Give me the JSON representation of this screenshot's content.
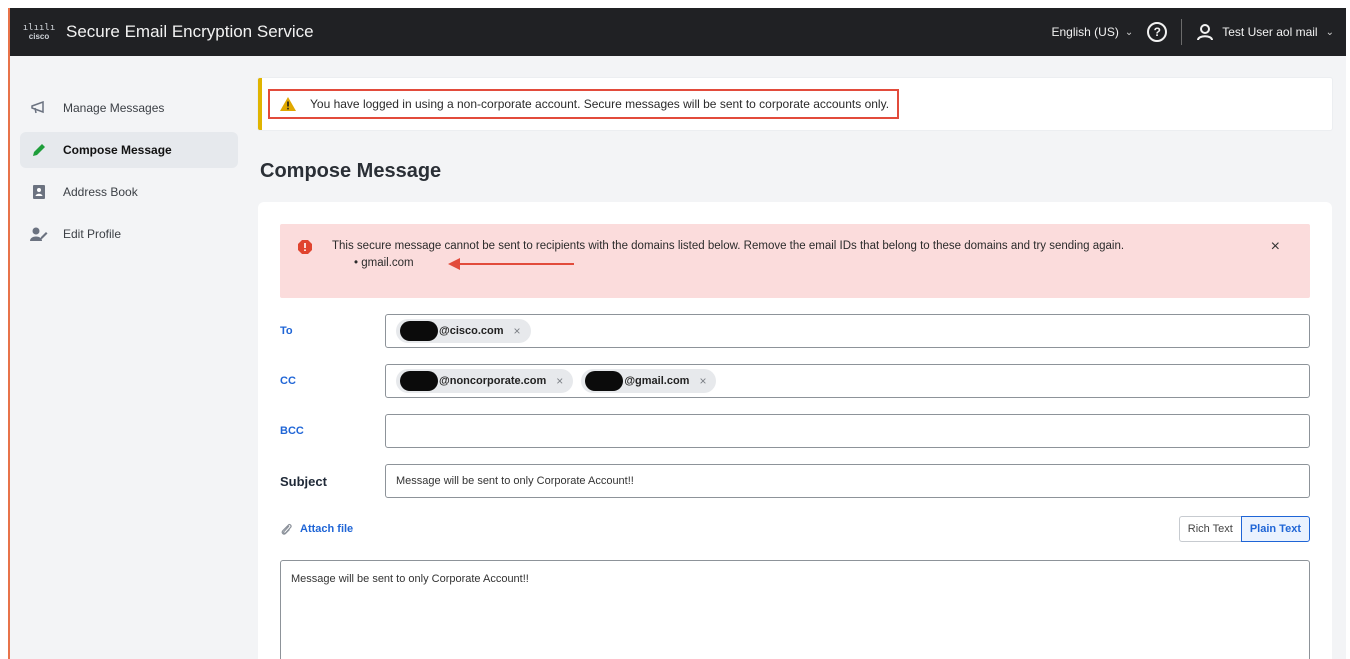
{
  "header": {
    "logo_text": "cisco",
    "app_title": "Secure Email Encryption Service",
    "language": "English (US)",
    "help_icon": "help-circle-icon",
    "user_name": "Test User aol mail"
  },
  "sidebar": {
    "items": [
      {
        "label": "Manage Messages",
        "icon": "megaphone-icon",
        "active": false
      },
      {
        "label": "Compose Message",
        "icon": "pencil-icon",
        "active": true
      },
      {
        "label": "Address Book",
        "icon": "address-book-icon",
        "active": false
      },
      {
        "label": "Edit Profile",
        "icon": "user-edit-icon",
        "active": false
      }
    ]
  },
  "banner": {
    "text": "You have logged in using a non-corporate account. Secure messages will be sent to corporate accounts only.",
    "accent_color": "#e0b400"
  },
  "page_title": "Compose Message",
  "error": {
    "text": "This secure message cannot be sent to recipients with the domains listed below. Remove the email IDs that belong to these domains and try sending again.",
    "domain": "gmail.com",
    "bg_color": "#fbdcdc"
  },
  "form": {
    "to_label": "To",
    "to_chips": [
      "@cisco.com"
    ],
    "cc_label": "CC",
    "cc_chips": [
      "@noncorporate.com",
      "@gmail.com"
    ],
    "bcc_label": "BCC",
    "subject_label": "Subject",
    "subject_value": "Message will be sent to only Corporate Account!!",
    "attach_label": "Attach file",
    "rich_text_label": "Rich Text",
    "plain_text_label": "Plain Text",
    "body_value": "Message will be sent to only Corporate Account!!"
  }
}
